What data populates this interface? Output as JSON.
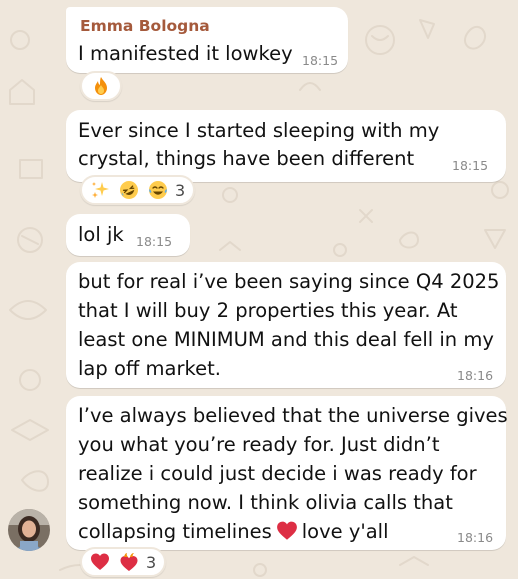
{
  "chat": {
    "messages": [
      {
        "sender": "Emma Bologna",
        "lines": [
          "I manifested it lowkey"
        ],
        "time": "18:15",
        "reactions": {
          "emojis": [
            "fire-icon"
          ],
          "count": ""
        }
      },
      {
        "lines": [
          "Ever since I started sleeping with my",
          "crystal, things have been different"
        ],
        "time": "18:15",
        "reactions": {
          "emojis": [
            "sparkles-icon",
            "rofl-icon",
            "joy-icon"
          ],
          "count": "3"
        }
      },
      {
        "lines": [
          "lol jk"
        ],
        "time": "18:15"
      },
      {
        "lines": [
          "but for real i’ve been saying since Q4 2025",
          "that I will buy 2 properties this year. At",
          "least one MINIMUM and this deal fell in my",
          "lap off market."
        ],
        "time": "18:16"
      },
      {
        "lines": [
          "I’ve always believed that the universe gives",
          "you what you’re ready for. Just didn’t",
          "realize i could just decide i was ready for",
          "something now. I think olivia calls that",
          "collapsing timelines",
          "love y'all"
        ],
        "inline_emoji": "red-heart-icon",
        "time": "18:16",
        "reactions": {
          "emojis": [
            "red-heart-icon",
            "heart-on-fire-icon"
          ],
          "count": "3"
        }
      }
    ]
  },
  "colors": {
    "background": "#efe7dc",
    "bubble": "#ffffff",
    "sender_name": "#a55a3c",
    "timestamp": "#8a8a8a"
  }
}
